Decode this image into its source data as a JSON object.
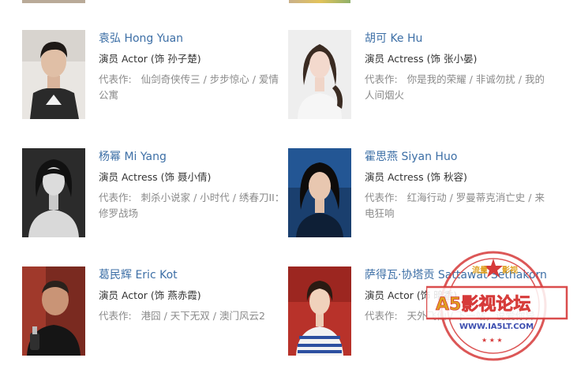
{
  "actors": [
    {
      "name": "袁弘 Hong Yuan",
      "role": "演员 Actor (饰 孙子楚)",
      "works_label": "代表作:",
      "works": "仙剑奇侠传三 / 步步惊心 / 爱情公寓"
    },
    {
      "name": "胡可 Ke Hu",
      "role": "演员 Actress (饰 张小晏)",
      "works_label": "代表作:",
      "works": "你是我的荣耀 / 非诚勿扰 / 我的人间烟火"
    },
    {
      "name": "杨幂 Mi Yang",
      "role": "演员 Actress (饰 聂小倩)",
      "works_label": "代表作:",
      "works": "刺杀小说家 / 小时代 / 绣春刀II：修罗战场"
    },
    {
      "name": "霍思燕 Siyan Huo",
      "role": "演员 Actress (饰 秋容)",
      "works_label": "代表作:",
      "works": "红海行动 / 罗曼蒂克消亡史 / 来电狂响"
    },
    {
      "name": "葛民辉 Eric Kot",
      "role": "演员 Actor (饰 燕赤霞)",
      "works_label": "代表作:",
      "works": "港囧 / 天下无双 / 澳门风云2"
    },
    {
      "name": "萨得瓦·协塔贡 Sattawat Sethakorn",
      "role": "演员 Actor (饰 暗香)",
      "works_label": "代表作:",
      "works": "天外飞仙 / 下一站，说爱你异"
    }
  ],
  "watermark": {
    "title": "A5影视论坛",
    "top_text_left": "流量",
    "top_text_right": "影视",
    "url": "WWW.IA5LT.COM",
    "color": "#d63a3a",
    "accent": "#f0c020"
  },
  "colors": {
    "name": "#3d6fa6",
    "role": "#333333",
    "works": "#8a8a8a"
  }
}
